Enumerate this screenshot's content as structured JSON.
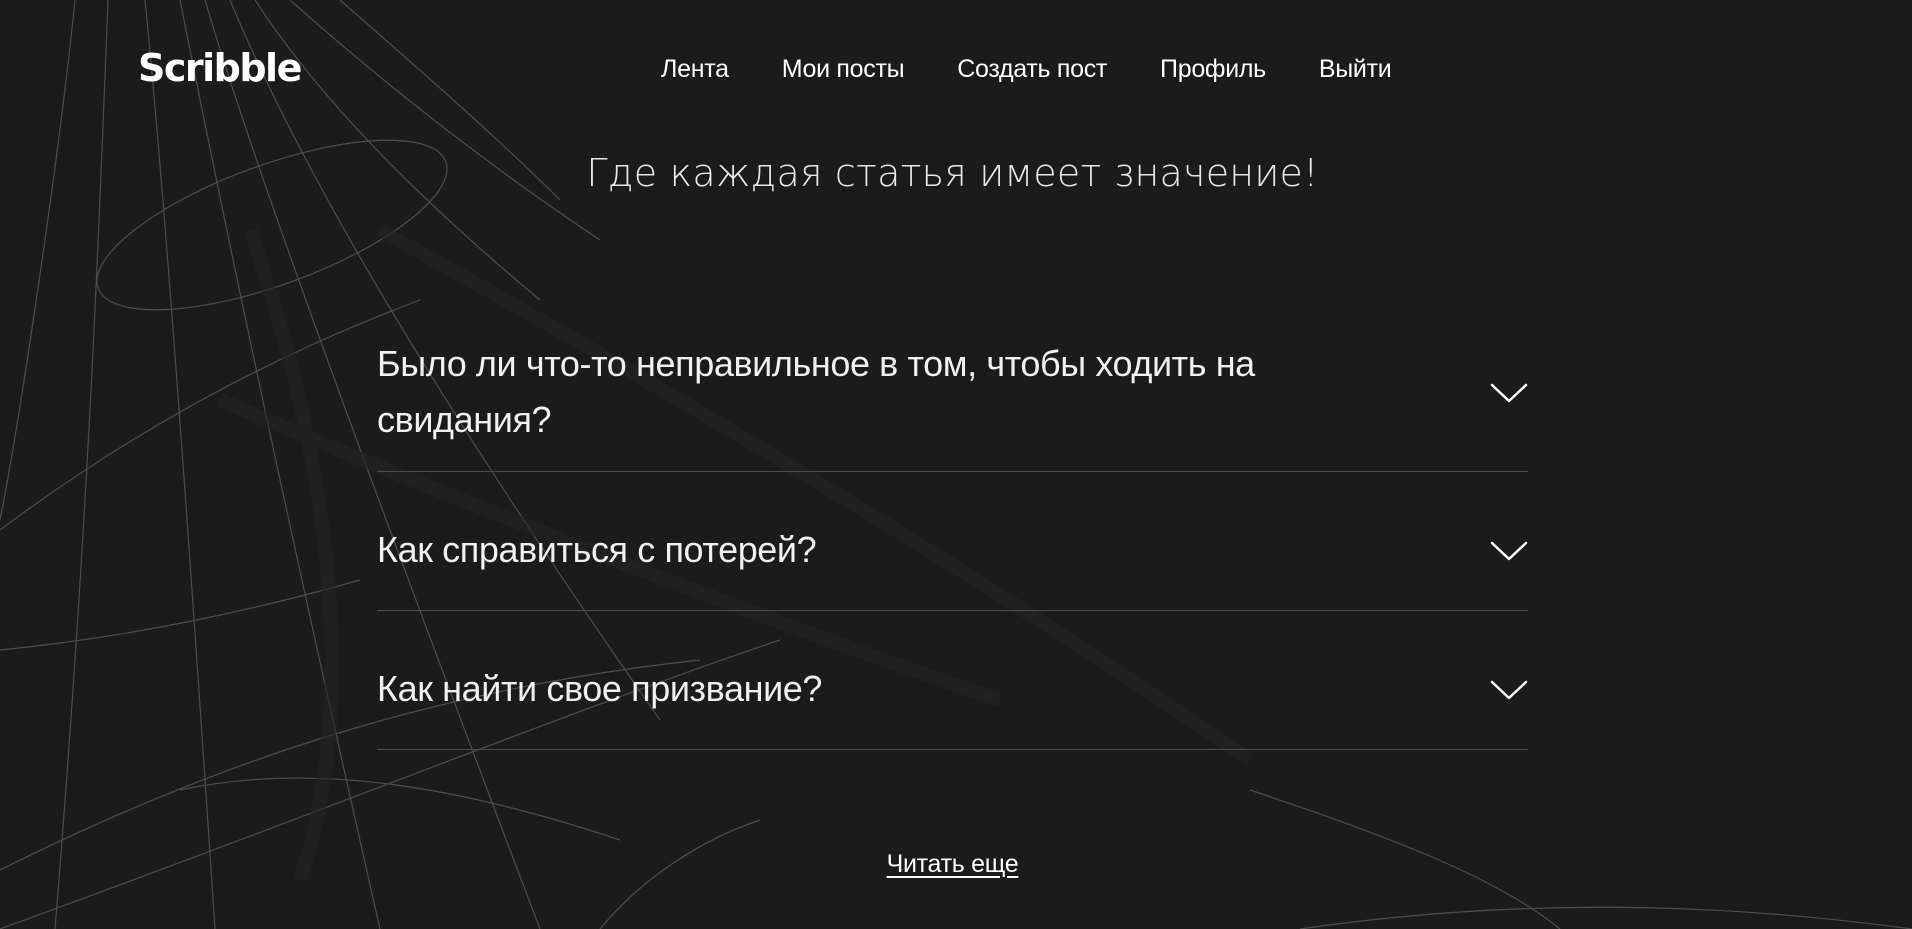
{
  "header": {
    "logo": "Scribble",
    "nav": [
      {
        "label": "Лента"
      },
      {
        "label": "Мои посты"
      },
      {
        "label": "Создать пост"
      },
      {
        "label": "Профиль"
      },
      {
        "label": "Выйти"
      }
    ]
  },
  "hero": {
    "tagline": "Где каждая статья имеет значение!"
  },
  "faq": {
    "items": [
      {
        "question": "Было ли что-то неправильное в том, чтобы ходить на свидания?",
        "icon": "chevron-down-icon"
      },
      {
        "question": "Как справиться с потерей?",
        "icon": "chevron-down-icon"
      },
      {
        "question": "Как найти свое призвание?",
        "icon": "chevron-down-icon"
      }
    ]
  },
  "footer": {
    "read_more": "Читать еще"
  },
  "colors": {
    "background": "#1b1b1b",
    "text": "#ffffff",
    "divider": "#4a4a4a",
    "decor_line": "#555555"
  }
}
